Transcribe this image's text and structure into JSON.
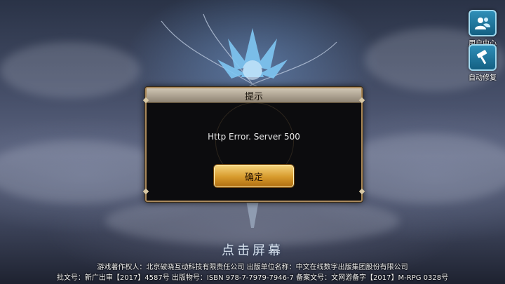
{
  "side_buttons": {
    "user_center": {
      "label": "用户中心",
      "icon": "users-icon"
    },
    "auto_repair": {
      "label": "自动修复",
      "icon": "hammer-icon"
    }
  },
  "dialog": {
    "title": "提示",
    "message": "Http Error. Server 500",
    "confirm_label": "确定"
  },
  "tap_prompt": "点击屏幕",
  "footer": {
    "line1": "游戏著作权人：北京破晓互动科技有限责任公司    出版单位名称：中文在线数字出版集团股份有限公司",
    "line2": "批文号：新广出审【2017】4587号    出版物号：ISBN 978-7-7979-7946-7    备案文号：文网游备字【2017】M-RPG 0328号"
  },
  "colors": {
    "dialog_border": "#a9885a",
    "button_gold": "#d79a2c",
    "side_button_blue": "#2f8fb8"
  }
}
